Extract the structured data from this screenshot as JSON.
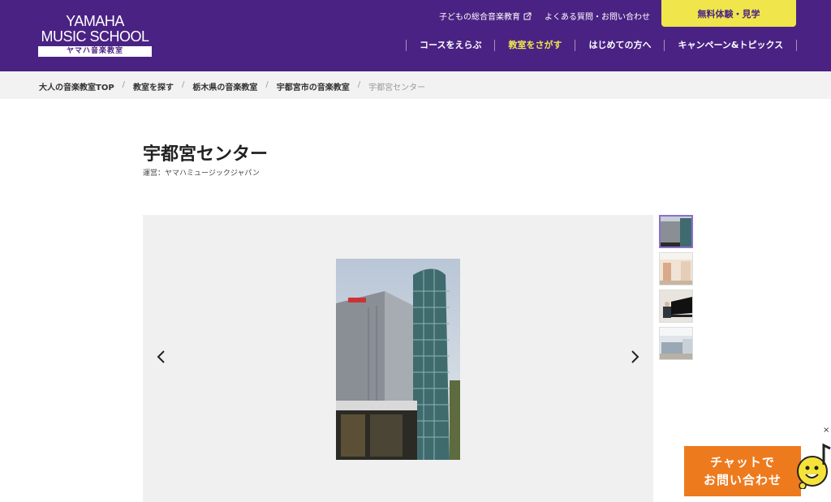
{
  "header": {
    "logo": {
      "line1": "YAMAHA",
      "line2": "MUSIC SCHOOL",
      "sub": "ヤマハ音楽教室"
    },
    "util_links": [
      {
        "label": "子どもの総合音楽教育",
        "external": true
      },
      {
        "label": "よくある質問・お問い合わせ",
        "external": false
      }
    ],
    "cta_label": "無料体験・見学",
    "nav": [
      {
        "label": "コースをえらぶ",
        "active": false
      },
      {
        "label": "教室をさがす",
        "active": true
      },
      {
        "label": "はじめての方へ",
        "active": false
      },
      {
        "label": "キャンペーン&トピックス",
        "active": false
      }
    ],
    "colors": {
      "brand": "#4a2283",
      "accent": "#f0e64c"
    }
  },
  "breadcrumb": [
    "大人の音楽教室TOP",
    "教室を探す",
    "栃木県の音楽教室",
    "宇都宮市の音楽教室",
    "宇都宮センター"
  ],
  "page": {
    "title": "宇都宮センター",
    "operator": "運営：ヤマハミュージックジャパン"
  },
  "gallery": {
    "prev_icon": "chevron-left-icon",
    "next_icon": "chevron-right-icon",
    "active_index": 0,
    "thumb_count": 4
  },
  "chat": {
    "line1": "チャットで",
    "line2": "お問い合わせ",
    "close_label": "×",
    "color": "#ee7a1e"
  }
}
